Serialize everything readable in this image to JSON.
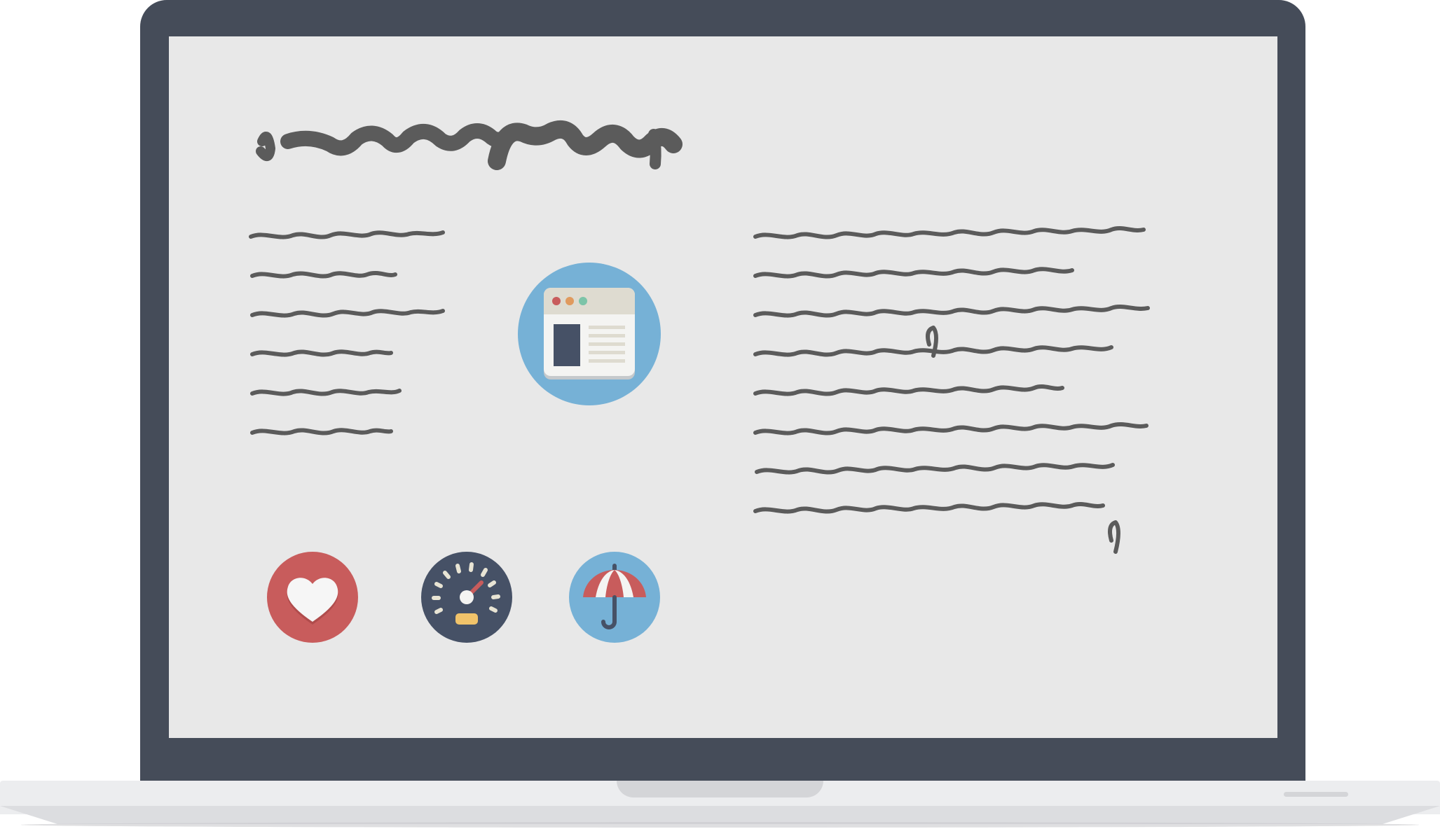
{
  "illustration": {
    "subject": "laptop",
    "screen": {
      "heading_text": "",
      "left_column_lines": 6,
      "right_column_lines": 8
    },
    "icons": [
      {
        "name": "browser-window-icon"
      },
      {
        "name": "heart-icon"
      },
      {
        "name": "speedometer-icon"
      },
      {
        "name": "umbrella-icon"
      }
    ]
  },
  "colors": {
    "bezel": "#454c59",
    "screen": "#e8e8e8",
    "scribble": "#5b5b5b",
    "icon_blue": "#76b1d6",
    "icon_red": "#c85c5c",
    "icon_navy": "#465166"
  }
}
